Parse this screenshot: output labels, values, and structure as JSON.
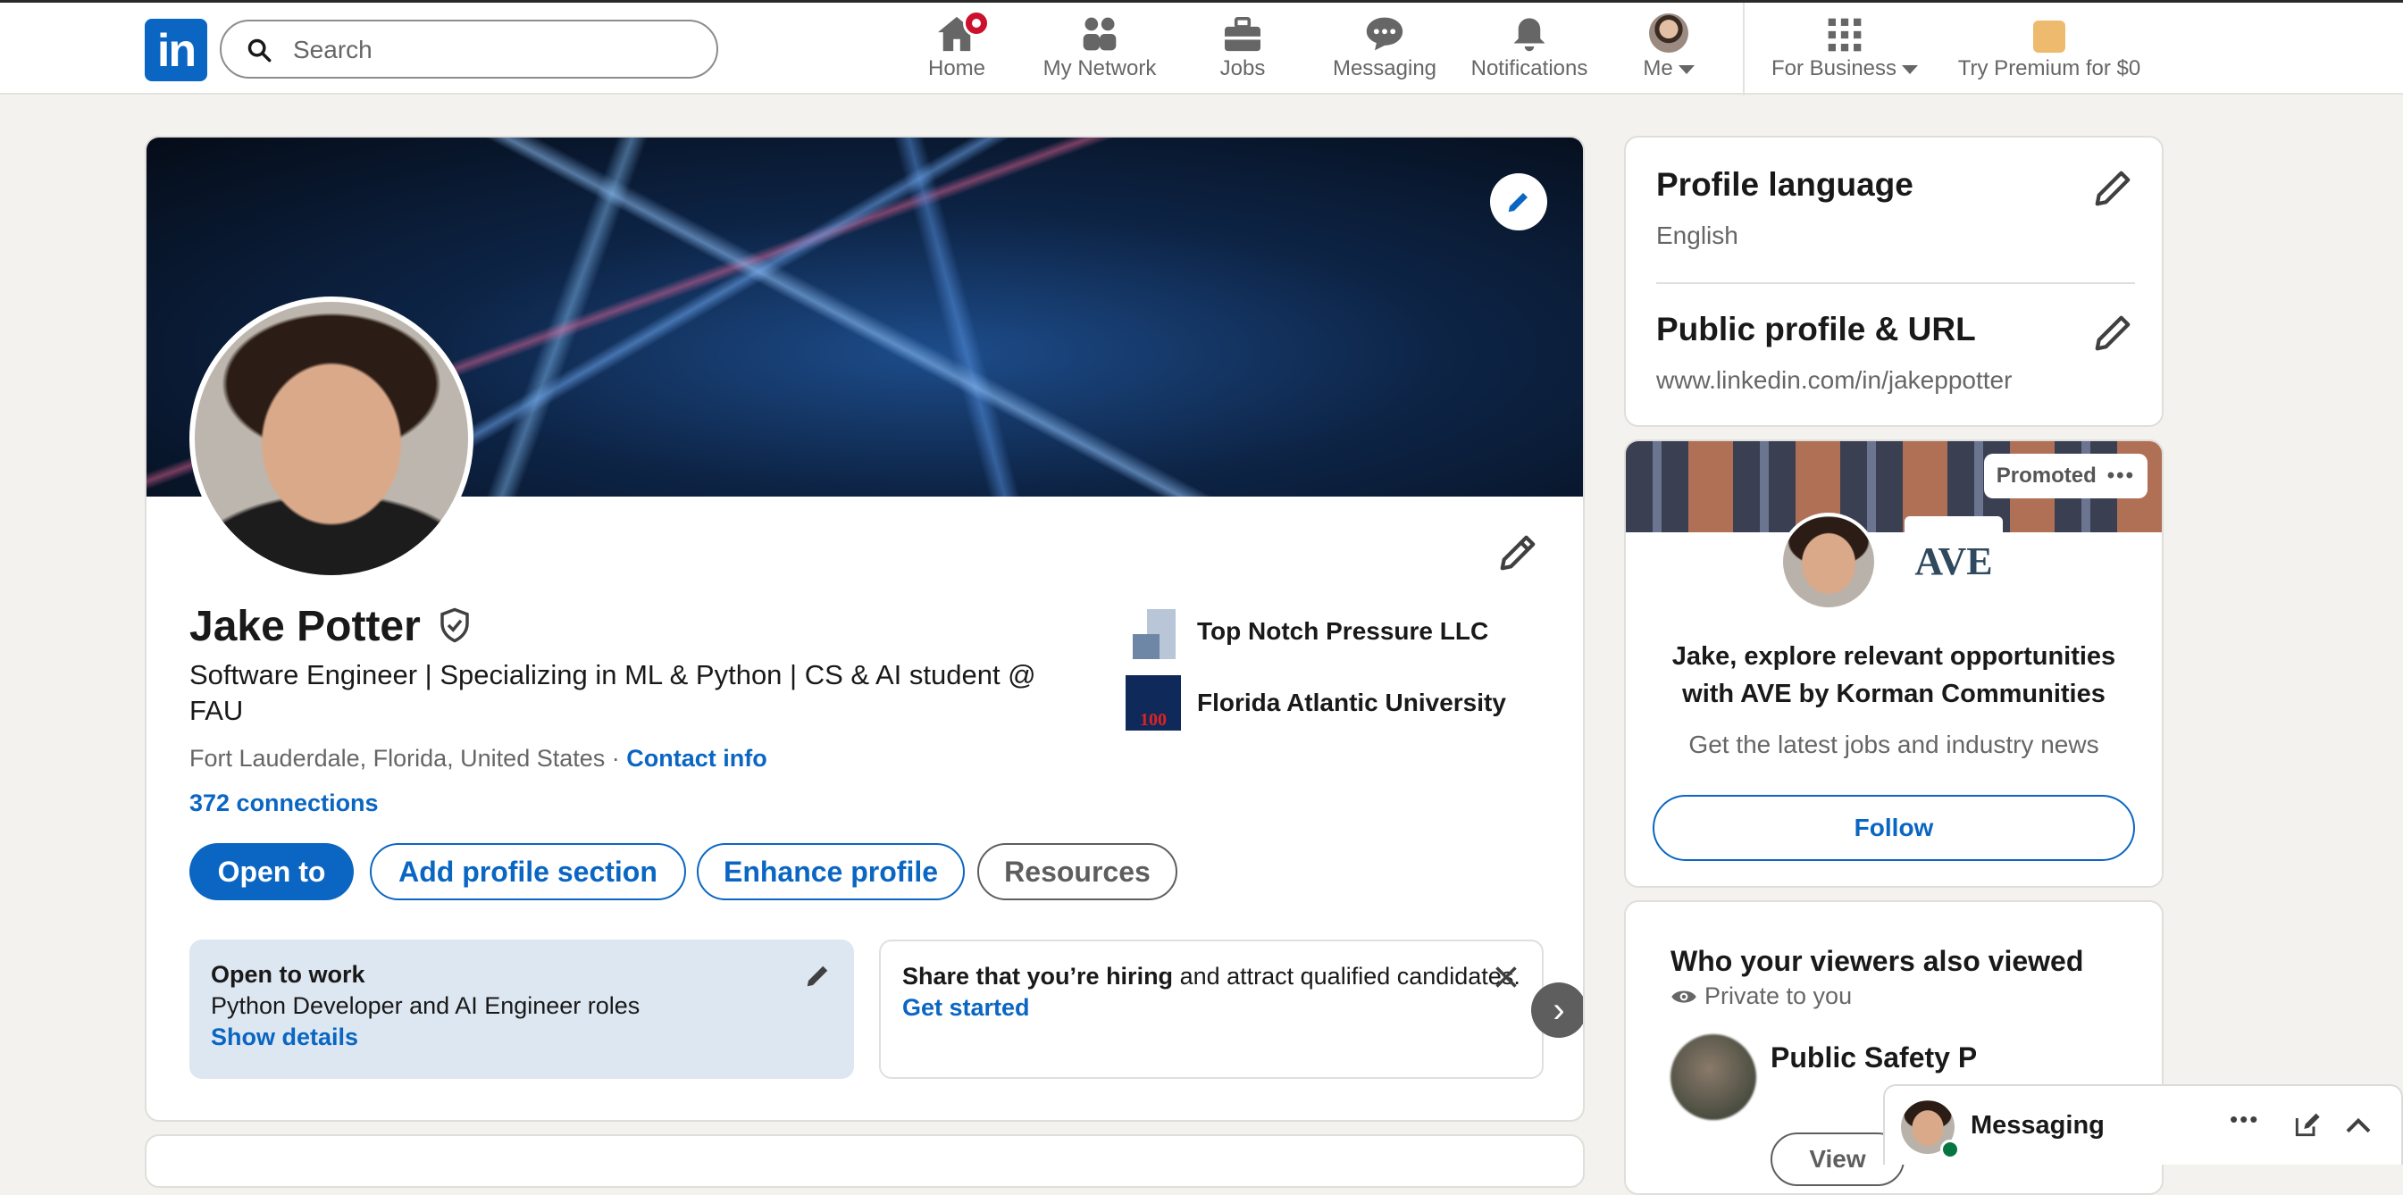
{
  "nav": {
    "search_placeholder": "Search",
    "items": [
      {
        "label": "Home"
      },
      {
        "label": "My Network"
      },
      {
        "label": "Jobs"
      },
      {
        "label": "Messaging"
      },
      {
        "label": "Notifications"
      },
      {
        "label": "Me"
      },
      {
        "label": "For Business"
      },
      {
        "label": "Try Premium for $0"
      }
    ],
    "logo_text": "in"
  },
  "profile": {
    "name": "Jake Potter",
    "headline": "Software Engineer | Specializing in ML & Python | CS & AI student @ FAU",
    "location": "Fort Lauderdale, Florida, United States",
    "separator": " · ",
    "contact_label": "Contact info",
    "connections": "372 connections",
    "buttons": {
      "open_to": "Open to",
      "add_section": "Add profile section",
      "enhance": "Enhance profile",
      "resources": "Resources"
    },
    "orgs": [
      {
        "name": "Top Notch Pressure LLC"
      },
      {
        "name": "Florida Atlantic University"
      }
    ],
    "fau_logo_text": "100",
    "open_to_work": {
      "title": "Open to work",
      "roles": "Python Developer and AI Engineer roles",
      "link": "Show details"
    },
    "hiring": {
      "bold": "Share that you’re hiring",
      "rest": " and attract qualified candidates.",
      "link": "Get started"
    }
  },
  "sidebar": {
    "profile_language": {
      "title": "Profile language",
      "value": "English"
    },
    "public_profile": {
      "title": "Public profile & URL",
      "value": "www.linkedin.com/in/jakeppotter"
    },
    "promo": {
      "pill": "Promoted",
      "logo": "AVE",
      "headline": "Jake, explore relevant opportunities with AVE by Korman Communities",
      "sub": "Get the latest jobs and industry news",
      "button": "Follow"
    },
    "viewers": {
      "title": "Who your viewers also viewed",
      "privacy": "Private to you",
      "person": "Public Safety Professio",
      "view_button": "View"
    }
  },
  "messaging": {
    "label": "Messaging"
  },
  "colors": {
    "brand": "#0a66c2",
    "notification": "#cb112d",
    "background": "#f4f2ee"
  }
}
